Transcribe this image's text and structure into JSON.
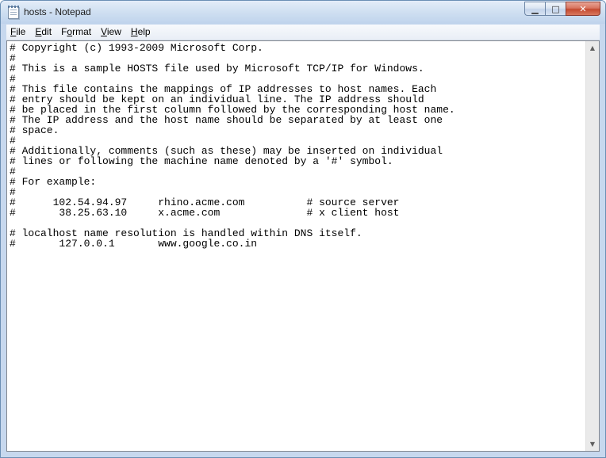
{
  "window": {
    "title": "hosts - Notepad"
  },
  "caption": {
    "minimize_icon": "minimize-icon",
    "maximize_icon": "maximize-icon",
    "close_icon": "close-icon"
  },
  "menu": [
    {
      "access": "F",
      "rest": "ile"
    },
    {
      "access": "E",
      "rest": "dit"
    },
    {
      "pre": "F",
      "access": "o",
      "rest": "rmat"
    },
    {
      "access": "V",
      "rest": "iew"
    },
    {
      "access": "H",
      "rest": "elp"
    }
  ],
  "document": {
    "lines": [
      "# Copyright (c) 1993-2009 Microsoft Corp.",
      "#",
      "# This is a sample HOSTS file used by Microsoft TCP/IP for Windows.",
      "#",
      "# This file contains the mappings of IP addresses to host names. Each",
      "# entry should be kept on an individual line. The IP address should",
      "# be placed in the first column followed by the corresponding host name.",
      "# The IP address and the host name should be separated by at least one",
      "# space.",
      "#",
      "# Additionally, comments (such as these) may be inserted on individual",
      "# lines or following the machine name denoted by a '#' symbol.",
      "#",
      "# For example:",
      "#",
      "#      102.54.94.97     rhino.acme.com          # source server",
      "#       38.25.63.10     x.acme.com              # x client host",
      "",
      "# localhost name resolution is handled within DNS itself.",
      "#       127.0.0.1       www.google.co.in"
    ]
  },
  "scrollbar": {
    "up_icon": "scroll-up-arrow-icon",
    "down_icon": "scroll-down-arrow-icon"
  }
}
